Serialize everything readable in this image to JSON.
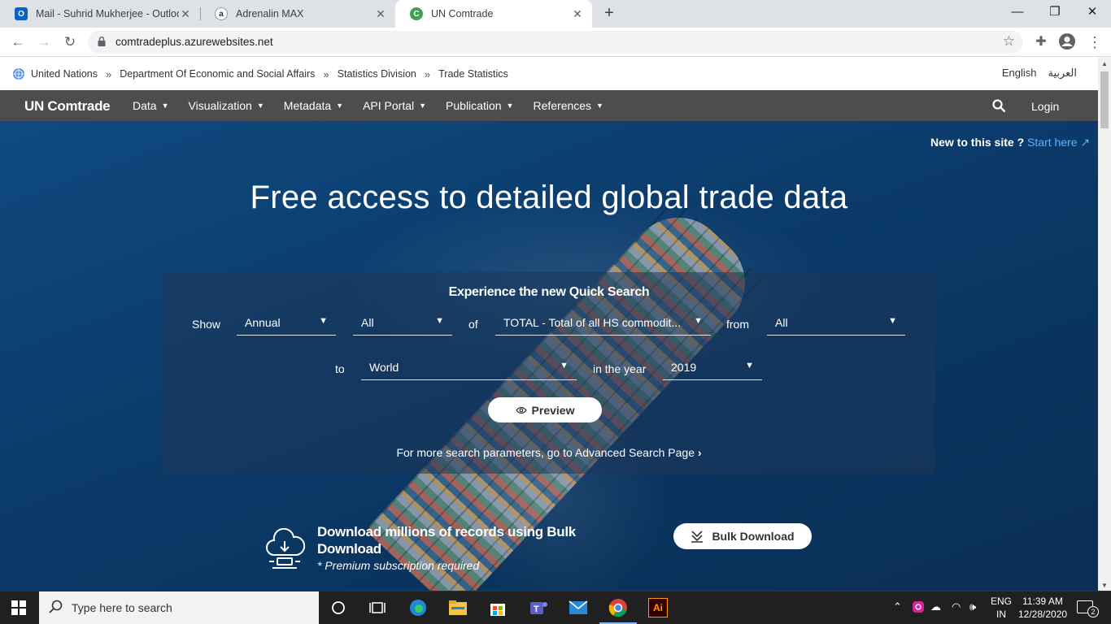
{
  "browser": {
    "tabs": [
      {
        "title": "Mail - Suhrid Mukherjee - Outlook",
        "favicon": "outlook-icon"
      },
      {
        "title": "Adrenalin MAX",
        "favicon": "adrenalin-icon"
      },
      {
        "title": "UN Comtrade",
        "favicon": "comtrade-icon"
      }
    ],
    "url": "comtradeplus.azurewebsites.net"
  },
  "unbar": {
    "crumbs": [
      "United Nations",
      "Department Of Economic and Social Affairs",
      "Statistics Division",
      "Trade Statistics"
    ],
    "separator": "»",
    "lang_en": "English",
    "lang_ar": "العربية"
  },
  "nav": {
    "brand": "UN Comtrade",
    "menu": [
      "Data",
      "Visualization",
      "Metadata",
      "API Portal",
      "Publication",
      "References"
    ],
    "login": "Login"
  },
  "hero": {
    "new_to_site": "New to this site ?",
    "start_here": "Start here",
    "title": "Free access to detailed global trade data"
  },
  "quick_search": {
    "title": "Experience the new Quick Search",
    "label_show": "Show",
    "frequency": "Annual",
    "flow": "All",
    "label_of": "of",
    "commodity": "TOTAL - Total of all HS commodit...",
    "label_from": "from",
    "reporter": "All",
    "label_to": "to",
    "partner": "World",
    "label_year": "in the year",
    "year": "2019",
    "preview": "Preview",
    "advanced": "For more search parameters, go to Advanced Search Page"
  },
  "bulk": {
    "heading": "Download millions of records using Bulk Download",
    "note": "* Premium subscription required",
    "button": "Bulk Download"
  },
  "taskbar": {
    "search_placeholder": "Type here to search",
    "lang_line1": "ENG",
    "lang_line2": "IN",
    "time": "11:39 AM",
    "date": "12/28/2020",
    "notification_count": "2"
  }
}
